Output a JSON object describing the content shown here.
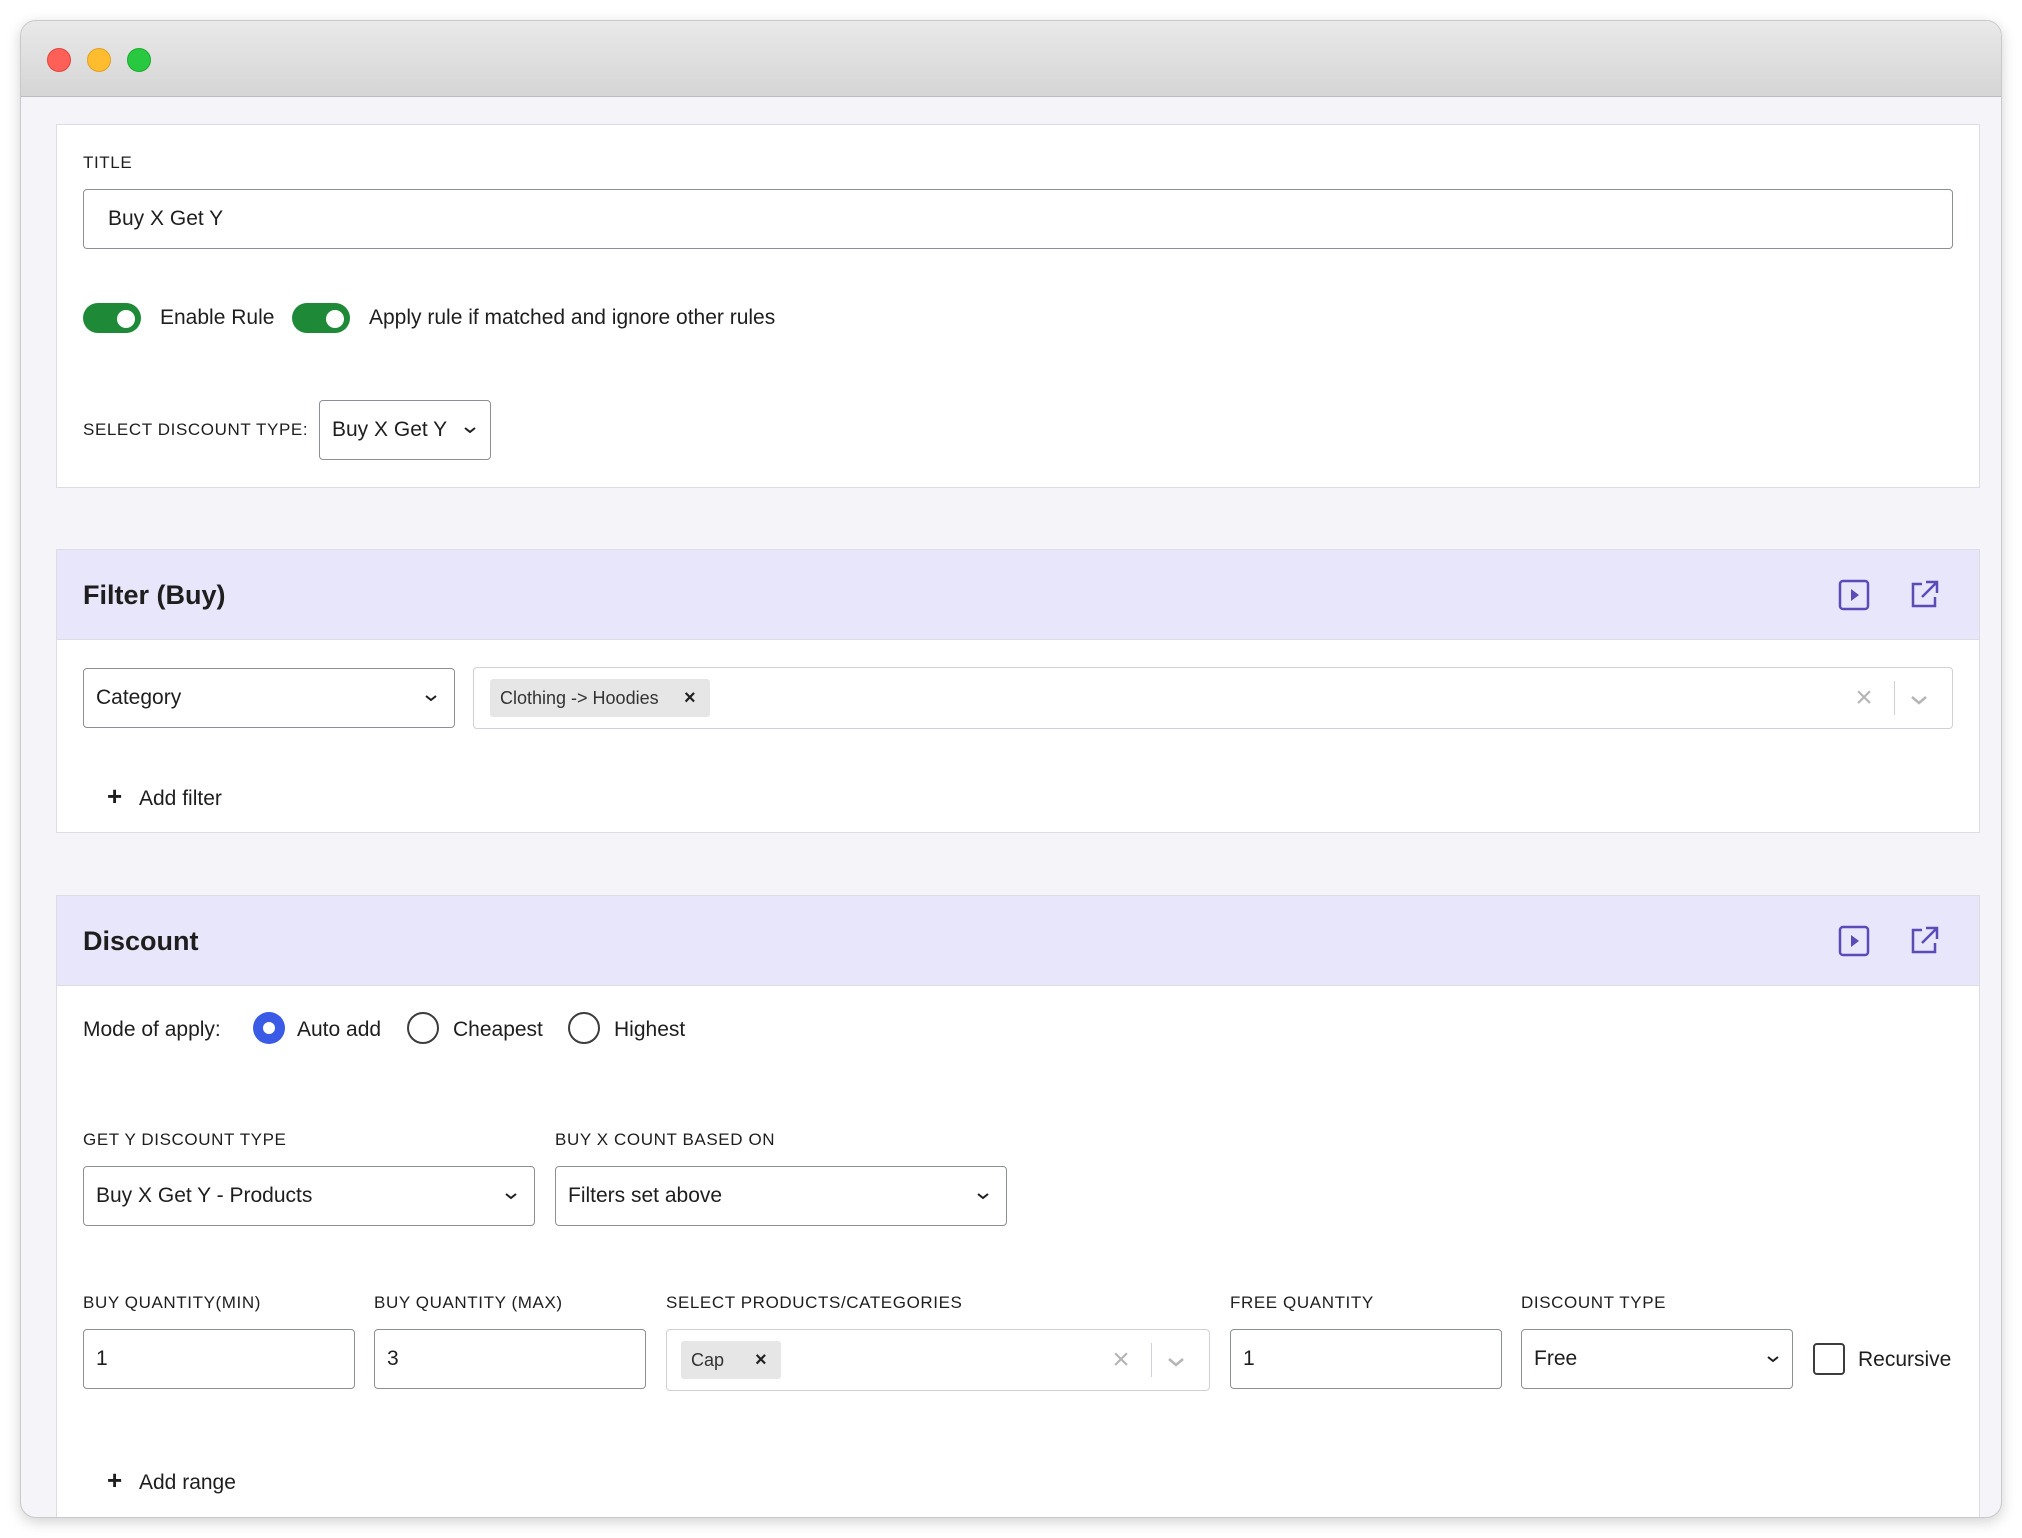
{
  "rule": {
    "title_label": "TITLE",
    "title_value": "Buy X Get Y",
    "enable_rule_label": "Enable Rule",
    "apply_rule_label": "Apply rule if matched and ignore other rules",
    "discount_type_label": "SELECT DISCOUNT TYPE:",
    "discount_type_value": "Buy X Get Y"
  },
  "filter_section": {
    "title": "Filter (Buy)",
    "filter_type": "Category",
    "selected_chip": "Clothing -> Hoodies",
    "add_filter_label": "Add filter"
  },
  "discount_section": {
    "title": "Discount",
    "mode_label": "Mode of apply:",
    "modes": [
      "Auto add",
      "Cheapest",
      "Highest"
    ],
    "selected_mode": "Auto add",
    "get_y_type_label": "GET Y DISCOUNT TYPE",
    "get_y_type_value": "Buy X Get Y - Products",
    "buy_x_count_label": "BUY X COUNT BASED ON",
    "buy_x_count_value": "Filters set above",
    "buy_min_label": "BUY QUANTITY(MIN)",
    "buy_min_value": "1",
    "buy_max_label": "BUY QUANTITY (MAX)",
    "buy_max_value": "3",
    "products_label": "SELECT PRODUCTS/CATEGORIES",
    "products_chip": "Cap",
    "free_qty_label": "FREE QUANTITY",
    "free_qty_value": "1",
    "discount_type_label": "DISCOUNT TYPE",
    "discount_type_value": "Free",
    "recursive_label": "Recursive",
    "add_range_label": "Add range"
  },
  "colors": {
    "toggle_on": "#1e8a38",
    "radio_selected": "#3a5be6",
    "section_header_bg": "#e8e6fb",
    "header_icon": "#5b4bb7"
  }
}
